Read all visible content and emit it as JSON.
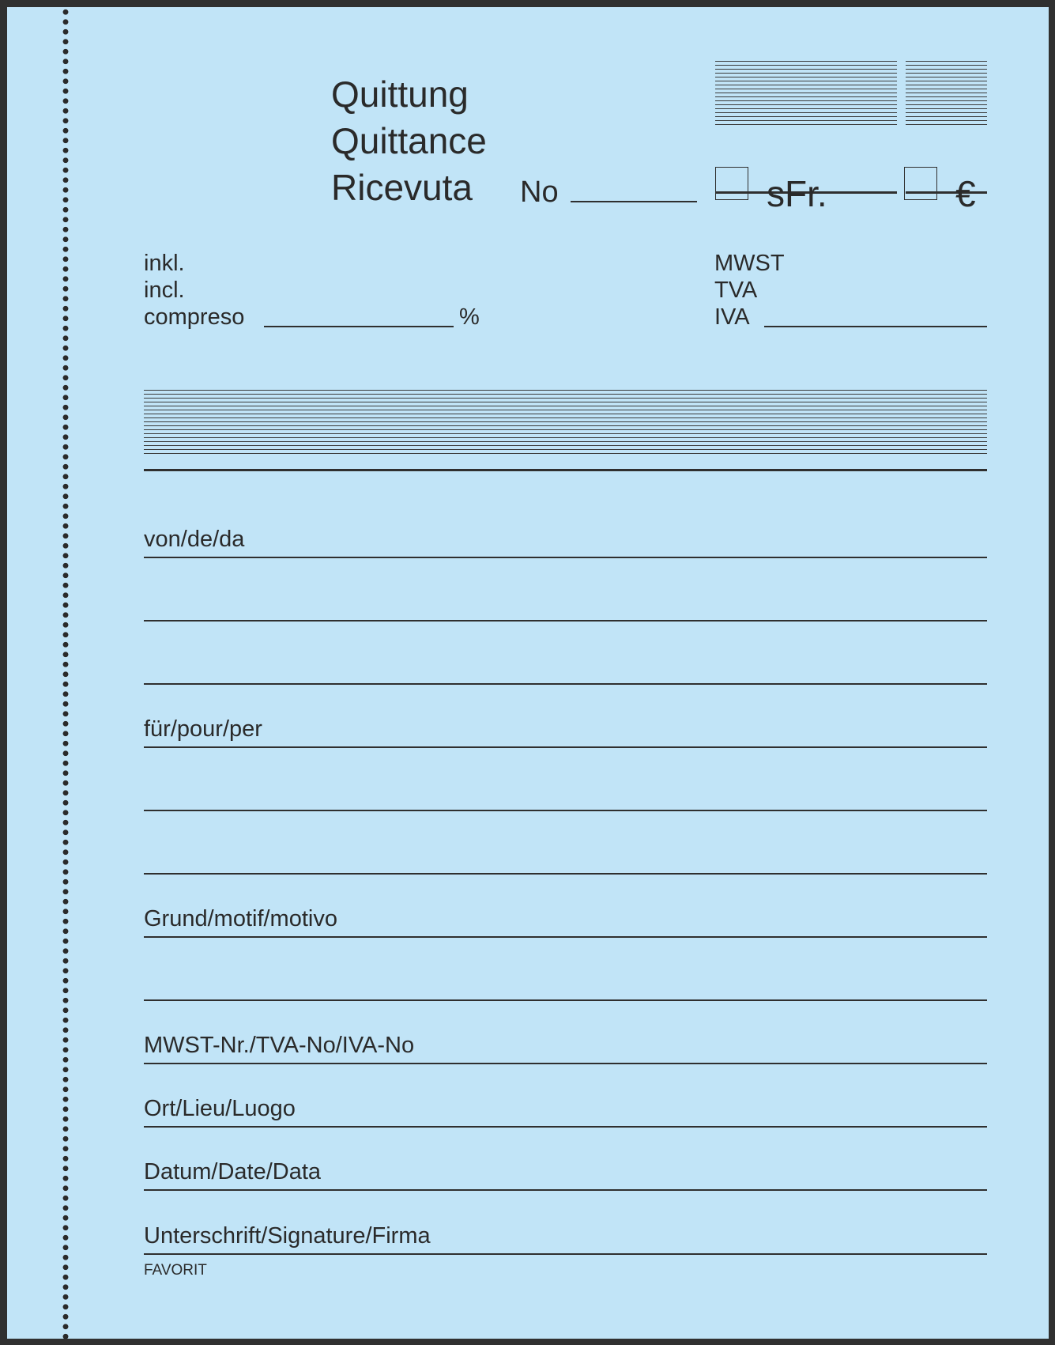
{
  "header": {
    "titles": [
      "Quittung",
      "Quittance",
      "Ricevuta"
    ],
    "number_label": "No",
    "currency_chf": "sFr.",
    "currency_eur": "€"
  },
  "tax": {
    "incl_labels": [
      "inkl.",
      "incl.",
      "compreso"
    ],
    "percent_sign": "%",
    "vat_labels": [
      "MWST",
      "TVA",
      "IVA"
    ]
  },
  "fields": {
    "from_label": "von/de/da",
    "for_label": "für/pour/per",
    "reason_label": "Grund/motif/motivo",
    "vat_no_label": "MWST-Nr./TVA-No/IVA-No",
    "place_label": "Ort/Lieu/Luogo",
    "date_label": "Datum/Date/Data",
    "signature_label": "Unterschrift/Signature/Firma"
  },
  "footer": {
    "brand": "FAVORIT"
  }
}
